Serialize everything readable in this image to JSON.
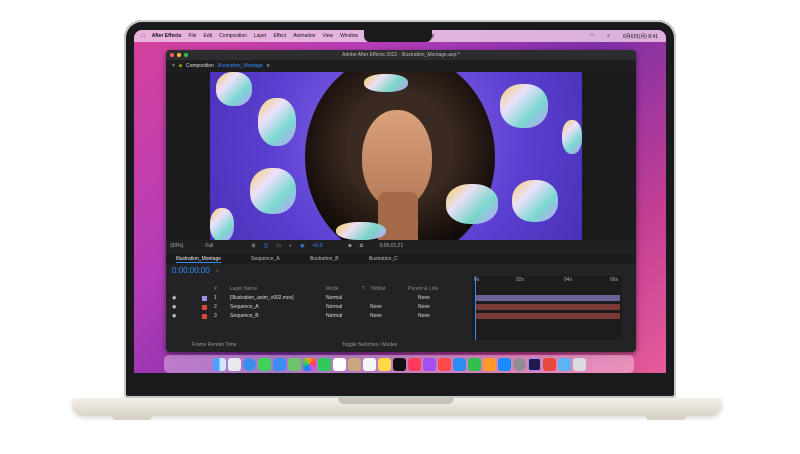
{
  "menubar": {
    "app": "After Effects",
    "items": [
      "File",
      "Edit",
      "Composition",
      "Layer",
      "Effect",
      "Animation",
      "View",
      "Window",
      "Help"
    ],
    "clock": "6月6日(月) 8:41"
  },
  "window": {
    "title": "Adobe After Effects 2022 - Illustration_Montage.aep *"
  },
  "composition": {
    "label": "Composition",
    "name": "Illustration_Montage"
  },
  "viewer_bar": {
    "zoom": "(50%)",
    "resolution": "Full",
    "exposure": "+0.0",
    "time": "0;00;01;21"
  },
  "tabs": [
    "Illustration_Montage",
    "Sequence_A",
    "Illustration_B",
    "Illustration_C"
  ],
  "timeline": {
    "timecode": "0:00:00:00",
    "search_placeholder": "⌕",
    "headers": {
      "num": "#",
      "layer_name": "Layer Name",
      "mode": "Mode",
      "t": "T",
      "trkmat": "TrkMat",
      "parent": "Parent & Link"
    },
    "layers": [
      {
        "num": "1",
        "name": "[Illustration_anim_v902.mov]",
        "mode": "Normal",
        "trkmat": "",
        "parent": "None",
        "color": "#a28de0"
      },
      {
        "num": "2",
        "name": "Sequence_A",
        "mode": "Normal",
        "trkmat": "None",
        "parent": "None",
        "color": "#d9473d"
      },
      {
        "num": "3",
        "name": "Sequence_B",
        "mode": "Normal",
        "trkmat": "None",
        "parent": "None",
        "color": "#d9473d"
      }
    ],
    "ruler": [
      "0s",
      "02s",
      "04s",
      "06s"
    ],
    "footer_left": "Frame Render Time",
    "footer_right": "Toggle Switches / Modes"
  }
}
